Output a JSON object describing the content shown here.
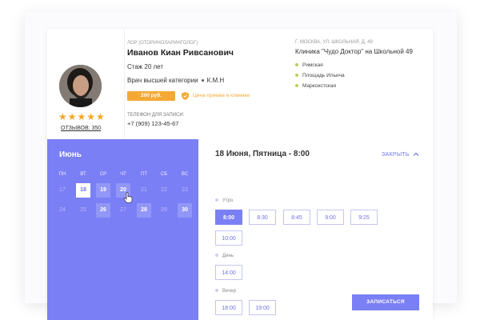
{
  "doctor": {
    "specialty": "ЛОР (оториноларинголог)",
    "name": "Иванов Киан Ривсанович",
    "experience": "Стаж 20 лет",
    "category": "Врач высшей категории",
    "degree": "К.М.Н",
    "rating": 5,
    "stars_text": "★★★★★",
    "reviews": "ОТЗЫВОВ: 350",
    "price": "200 руб.",
    "price_note": "Цена приема в клинике",
    "phone_label": "Телефон для записи:",
    "phone": "+7 (909) 123-45-67"
  },
  "clinic": {
    "address": "г. Москва, ул. Школьная, д. 49",
    "name": "Клиника \"Чудо Доктор\" на Школьной 49",
    "metro": [
      "Римская",
      "Площадь Ильича",
      "Марксистская"
    ]
  },
  "calendar": {
    "month": "Июнь",
    "weekdays": [
      "ПН",
      "ВТ",
      "СР",
      "ЧТ",
      "ПТ",
      "СБ",
      "ВС"
    ],
    "weeks": [
      [
        {
          "label": "17",
          "state": "disabled"
        },
        {
          "label": "18",
          "state": "selected"
        },
        {
          "label": "19",
          "state": "available"
        },
        {
          "label": "20",
          "state": "available"
        },
        {
          "label": "21",
          "state": "disabled"
        },
        {
          "label": "22",
          "state": "disabled"
        },
        {
          "label": "23",
          "state": "disabled"
        }
      ],
      [
        {
          "label": "24",
          "state": "disabled"
        },
        {
          "label": "25",
          "state": "disabled"
        },
        {
          "label": "26",
          "state": "available"
        },
        {
          "label": "27",
          "state": "disabled"
        },
        {
          "label": "28",
          "state": "available"
        },
        {
          "label": "29",
          "state": "disabled"
        },
        {
          "label": "30",
          "state": "available"
        }
      ]
    ]
  },
  "slots": {
    "title": "18 Июня, Пятница - 8:00",
    "close_label": "ЗАКРЫТЬ",
    "periods": [
      {
        "name": "Утро",
        "times": [
          "8:00",
          "8:30",
          "8:45",
          "9:00",
          "9:25",
          "10:00"
        ],
        "selected": "8:00"
      },
      {
        "name": "День",
        "times": [
          "14:00"
        ],
        "selected": ""
      },
      {
        "name": "Вечер",
        "times": [
          "18:00",
          "19:00"
        ],
        "selected": ""
      }
    ],
    "book_label": "Записаться"
  },
  "colors": {
    "accent": "#7b7ff5",
    "price": "#f4a935",
    "star": "#f5a623",
    "metro_dot": "#b7d160"
  }
}
